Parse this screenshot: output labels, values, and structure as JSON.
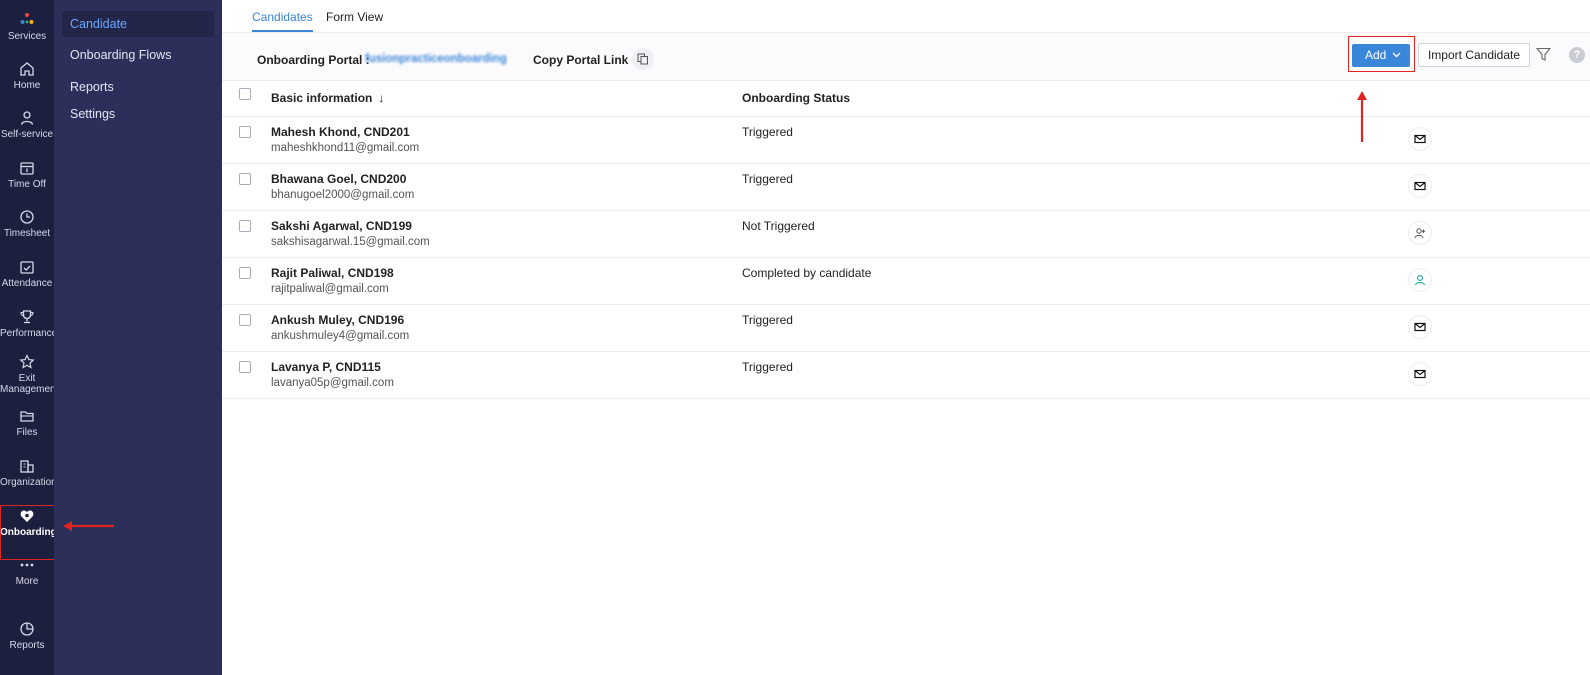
{
  "rail": {
    "items": [
      {
        "label": "Services",
        "icon": "services-icon"
      },
      {
        "label": "Home",
        "icon": "home-icon"
      },
      {
        "label": "Self-service",
        "icon": "person-icon"
      },
      {
        "label": "Time Off",
        "icon": "calendar-icon"
      },
      {
        "label": "Timesheet",
        "icon": "clock-icon"
      },
      {
        "label": "Attendance",
        "icon": "calendar-check-icon"
      },
      {
        "label": "Performance",
        "icon": "trophy-icon"
      },
      {
        "label": "Exit",
        "label2": "Management",
        "icon": "star-icon"
      },
      {
        "label": "Files",
        "icon": "folder-icon"
      },
      {
        "label": "Organization",
        "icon": "building-icon"
      },
      {
        "label": "Onboarding",
        "icon": "onboarding-icon"
      },
      {
        "label": "More",
        "icon": "more-icon"
      },
      {
        "label": "Reports",
        "icon": "pie-chart-icon"
      }
    ]
  },
  "submenu": {
    "items": [
      {
        "label": "Candidate",
        "active": true
      },
      {
        "label": "Onboarding Flows"
      },
      {
        "label": "Reports"
      },
      {
        "label": "Settings"
      }
    ]
  },
  "tabs": [
    {
      "label": "Candidates",
      "active": true
    },
    {
      "label": "Form View"
    }
  ],
  "toolbar": {
    "portal_label": "Onboarding Portal :",
    "portal_value": "fusionpracticeonboarding",
    "copy_link_label": "Copy Portal Link",
    "add_label": "Add",
    "import_label": "Import Candidate",
    "help_label": "?"
  },
  "table": {
    "columns": [
      "Basic information",
      "Onboarding Status"
    ],
    "sort_indicator": "↓",
    "rows": [
      {
        "name": "Mahesh Khond, CND201",
        "email": "maheshkhond11@gmail.com",
        "status": "Triggered",
        "action": "mail-icon"
      },
      {
        "name": "Bhawana Goel, CND200",
        "email": "bhanugoel2000@gmail.com",
        "status": "Triggered",
        "action": "mail-icon"
      },
      {
        "name": "Sakshi Agarwal, CND199",
        "email": "sakshisagarwal.15@gmail.com",
        "status": "Not Triggered",
        "action": "add-user-icon"
      },
      {
        "name": "Rajit Paliwal, CND198",
        "email": "rajitpaliwal@gmail.com",
        "status": "Completed by candidate",
        "action": "user-check-icon"
      },
      {
        "name": "Ankush Muley, CND196",
        "email": "ankushmuley4@gmail.com",
        "status": "Triggered",
        "action": "mail-icon"
      },
      {
        "name": "Lavanya P, CND115",
        "email": "lavanya05p@gmail.com",
        "status": "Triggered",
        "action": "mail-icon"
      }
    ]
  },
  "colors": {
    "rail_bg": "#1d1f3f",
    "submenu_bg": "#2c2f59",
    "accent": "#3a86d9",
    "annotation": "#e02424"
  }
}
